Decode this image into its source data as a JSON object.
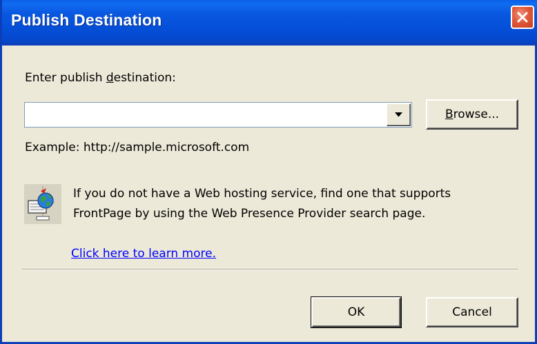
{
  "window": {
    "title": "Publish Destination"
  },
  "form": {
    "prompt_prefix": "Enter publish ",
    "prompt_underlined": "d",
    "prompt_suffix": "estination:",
    "destination_value": "",
    "example_text": "Example: http://sample.microsoft.com"
  },
  "buttons": {
    "browse_underlined": "B",
    "browse_rest": "rowse...",
    "ok": "OK",
    "cancel": "Cancel"
  },
  "info": {
    "line1": "If you do not have a Web hosting service, find one that supports",
    "line2": "FrontPage by using the Web Presence Provider search page.",
    "link": "Click here to learn more."
  },
  "icons": {
    "close": "close-icon",
    "dropdown": "chevron-down-icon",
    "web_hosting": "web-publish-icon"
  }
}
